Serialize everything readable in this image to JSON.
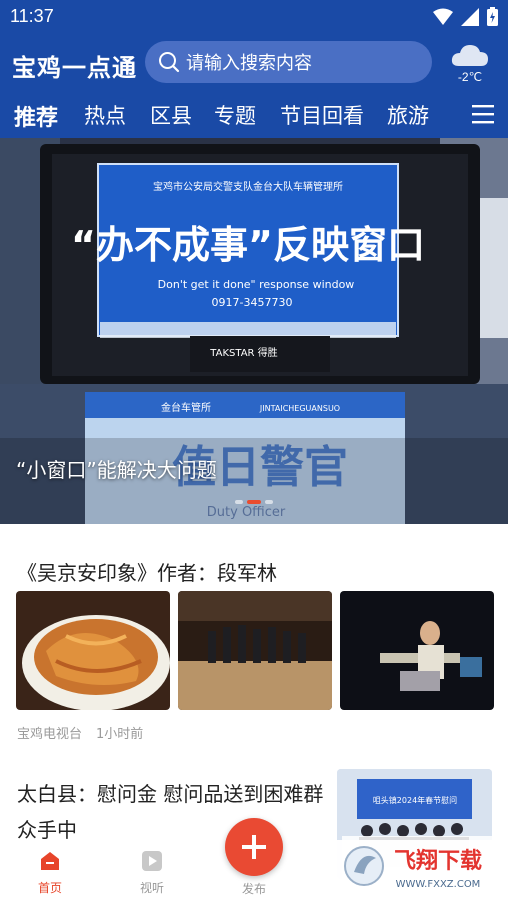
{
  "status_bar": {
    "time": "11:37"
  },
  "header": {
    "logo": "宝鸡一点通",
    "search_placeholder": "请输入搜索内容",
    "weather": {
      "icon": "cloud-icon",
      "temperature": "-2℃"
    }
  },
  "nav": {
    "tabs": [
      "推荐",
      "热点",
      "区县",
      "专题",
      "节目回看",
      "旅游"
    ],
    "active": "推荐"
  },
  "banner": {
    "caption": "“小窗口”能解决大问题",
    "slide_count": 3,
    "active_slide": 1,
    "sign_top": {
      "org": "宝鸡市公安局交警支队金台大队车辆管理所",
      "title": "“办不成事”反映窗口",
      "subtitle": "Don't get it done\" response window",
      "phone": "0917-3457730"
    },
    "sign_bottom": {
      "org": "金台车管所",
      "org_en": "JINTAICHEGUANSUO",
      "title": "值日警官",
      "title_en": "Duty Officer"
    },
    "monitor_brand": "TAKSTAR 得胜"
  },
  "articles": [
    {
      "title": "《吴京安印象》作者：段军林",
      "source": "宝鸡电视台",
      "time": "1小时前"
    },
    {
      "title": "太白县：慰问金 慰问品送到困难群众手中",
      "thumb_caption": "咀头镇2024年春节慰问"
    }
  ],
  "tabbar": {
    "items": [
      {
        "label": "首页",
        "icon": "home-icon",
        "active": true
      },
      {
        "label": "视听",
        "icon": "play-icon",
        "active": false
      },
      {
        "label": "发布",
        "icon": "plus-icon",
        "active": false
      }
    ]
  },
  "watermark": {
    "text_cn": "飞翔下载",
    "text_url": "WWW.FXXZ.COM"
  },
  "colors": {
    "brand": "#1a4aa6",
    "accent": "#e94a33"
  }
}
